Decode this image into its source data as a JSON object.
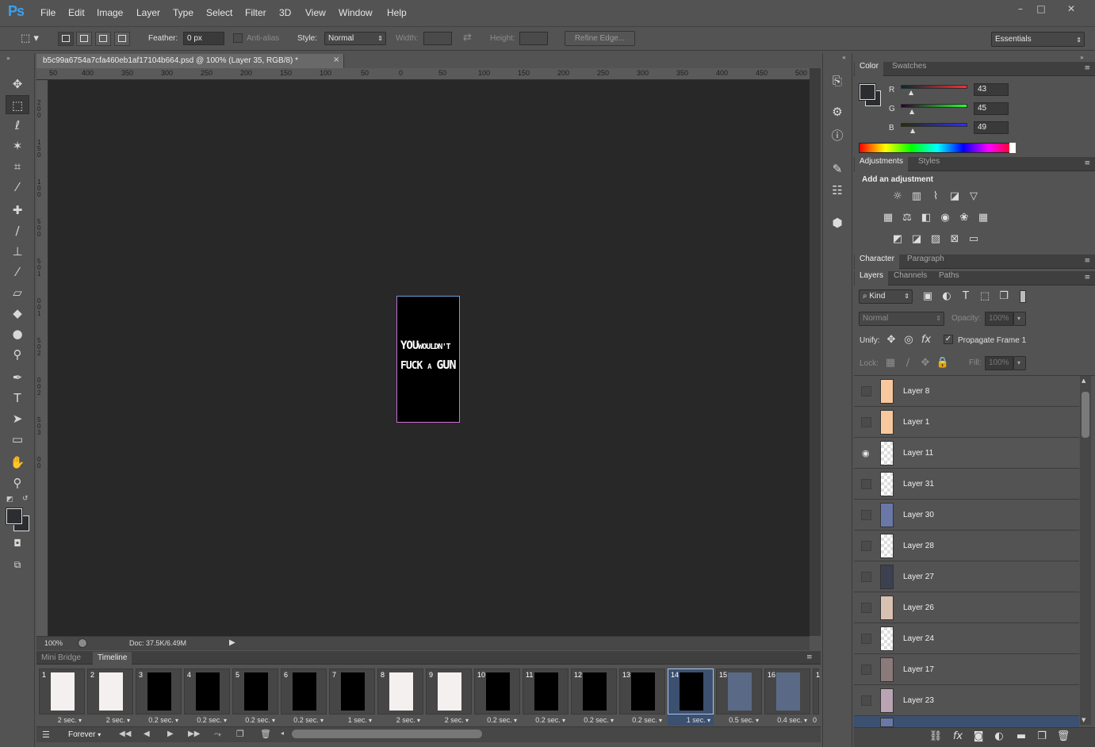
{
  "menubar": {
    "logo": "Ps",
    "items": [
      "File",
      "Edit",
      "Image",
      "Layer",
      "Type",
      "Select",
      "Filter",
      "3D",
      "View",
      "Window",
      "Help"
    ],
    "min": "–",
    "max": "□",
    "close": "✕"
  },
  "options": {
    "feather_label": "Feather:",
    "feather_value": "0 px",
    "antialias_label": "Anti-alias",
    "style_label": "Style:",
    "style_value": "Normal",
    "width_label": "Width:",
    "height_label": "Height:",
    "refine_label": "Refine Edge...",
    "workspace": "Essentials"
  },
  "document": {
    "tab_title": "b5c99a6754a7cfa460eb1af17104b664.psd @ 100% (Layer 35, RGB/8) *",
    "close": "×",
    "art_line1": "YOU WOULDN'T",
    "art_line1_big": "YOU",
    "art_line1_small": "WOULDN'T",
    "art_line2_a": "FUCK",
    "art_line2_b": "A",
    "art_line2_c": "GUN",
    "zoom": "100%",
    "doc_info": "Doc: 37.5K/6.49M",
    "hruler": [
      "50",
      "400",
      "350",
      "300",
      "250",
      "200",
      "150",
      "100",
      "50",
      "0",
      "50",
      "100",
      "150",
      "200",
      "250",
      "300",
      "350",
      "400",
      "450",
      "500"
    ],
    "vruler": [
      "2",
      "0",
      "0",
      "1",
      "5",
      "0",
      "1",
      "0",
      "0",
      "5",
      "0",
      "0",
      "5",
      "0",
      "1",
      "0",
      "0",
      "1",
      "5",
      "0",
      "2",
      "0",
      "0",
      "2",
      "5",
      "0",
      "3",
      "0",
      "0"
    ]
  },
  "timeline": {
    "tabs": [
      "Mini Bridge",
      "Timeline"
    ],
    "loop": "Forever",
    "frames": [
      {
        "n": "1",
        "t": "2 sec."
      },
      {
        "n": "2",
        "t": "2 sec."
      },
      {
        "n": "3",
        "t": "0.2 sec."
      },
      {
        "n": "4",
        "t": "0.2 sec."
      },
      {
        "n": "5",
        "t": "0.2 sec."
      },
      {
        "n": "6",
        "t": "0.2 sec."
      },
      {
        "n": "7",
        "t": "1 sec."
      },
      {
        "n": "8",
        "t": "2 sec."
      },
      {
        "n": "9",
        "t": "2 sec."
      },
      {
        "n": "10",
        "t": "0.2 sec."
      },
      {
        "n": "11",
        "t": "0.2 sec."
      },
      {
        "n": "12",
        "t": "0.2 sec."
      },
      {
        "n": "13",
        "t": "0.2 sec."
      },
      {
        "n": "14",
        "t": "1 sec."
      },
      {
        "n": "15",
        "t": "0.5 sec."
      },
      {
        "n": "16",
        "t": "0.4 sec."
      },
      {
        "n": "1",
        "t": "0"
      }
    ]
  },
  "color_panel": {
    "tabs": [
      "Color",
      "Swatches"
    ],
    "r_label": "R",
    "g_label": "G",
    "b_label": "B",
    "r": 43,
    "g": 45,
    "b": 49
  },
  "adjust_panel": {
    "tabs": [
      "Adjustments",
      "Styles"
    ],
    "title": "Add an adjustment"
  },
  "char_panel": {
    "tabs": [
      "Character",
      "Paragraph"
    ]
  },
  "layers_panel": {
    "tabs": [
      "Layers",
      "Channels",
      "Paths"
    ],
    "kind": "Kind",
    "blend": "Normal",
    "opacity_label": "Opacity:",
    "opacity": "100%",
    "unify_label": "Unify:",
    "propagate": "Propagate Frame 1",
    "lock_label": "Lock:",
    "fill_label": "Fill:",
    "fill": "100%",
    "layers": [
      {
        "name": "Layer 8",
        "visible": false,
        "thumb": "#f7c89d"
      },
      {
        "name": "Layer 1",
        "visible": false,
        "thumb": "#f7c89d"
      },
      {
        "name": "Layer 11",
        "visible": true,
        "thumb": "checker"
      },
      {
        "name": "Layer 31",
        "visible": false,
        "thumb": "checker"
      },
      {
        "name": "Layer 30",
        "visible": false,
        "thumb": "#6a78a8"
      },
      {
        "name": "Layer 28",
        "visible": false,
        "thumb": "checker"
      },
      {
        "name": "Layer 27",
        "visible": false,
        "thumb": "#3c4050"
      },
      {
        "name": "Layer 26",
        "visible": false,
        "thumb": "#d9c1b1"
      },
      {
        "name": "Layer 24",
        "visible": false,
        "thumb": "checker"
      },
      {
        "name": "Layer 17",
        "visible": false,
        "thumb": "#8a7a7a"
      },
      {
        "name": "Layer 23",
        "visible": false,
        "thumb": "#b9a4b4"
      }
    ]
  },
  "colors": {
    "accent": "#3aa1ee",
    "canvas": "#282828",
    "panel": "#535353",
    "selection": "#3c5070"
  }
}
